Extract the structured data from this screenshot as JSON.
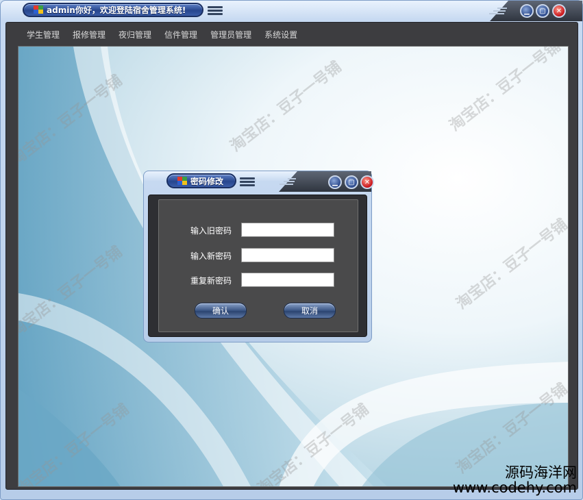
{
  "window": {
    "title": "admin你好，欢迎登陆宿舍管理系统!"
  },
  "menu": {
    "items": [
      "学生管理",
      "报修管理",
      "夜归管理",
      "信件管理",
      "管理员管理",
      "系统设置"
    ]
  },
  "dialog": {
    "title": "密码修改",
    "fields": [
      {
        "label": "输入旧密码",
        "value": ""
      },
      {
        "label": "输入新密码",
        "value": ""
      },
      {
        "label": "重复新密码",
        "value": ""
      }
    ],
    "confirm_label": "确认",
    "cancel_label": "取消"
  },
  "watermark": {
    "text": "淘宝店：豆子一号铺"
  },
  "brand": {
    "name": "源码海洋网",
    "url": "www.codehy.com"
  },
  "colors": {
    "title_pill": "#27468e",
    "client_bg": "#3d3d40",
    "close_button": "#c8141a"
  }
}
